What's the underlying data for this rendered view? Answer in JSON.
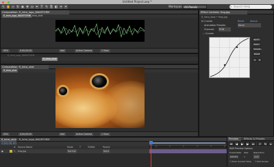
{
  "window": {
    "title": "Untitled Project.aep *"
  },
  "toolbar": {
    "workspace_label": "Workspace:",
    "workspace_value": "All Panels",
    "search_placeholder": "Search Help"
  },
  "composition_top": {
    "tab_label": "Composition: fl_intro_logo_WAVEFORM",
    "subtabs": [
      "fl_intro_logo_WAVEFORM",
      "fl_intro_shot"
    ],
    "zoom": "50%",
    "time": "0;00;00;00",
    "resolution": "Half",
    "camera": "Active Camera",
    "views": "1 View"
  },
  "layer_top": {
    "path": "fl_intro_logo_WAVEFORM",
    "subtab_active": "fl_intro_shot"
  },
  "composition_bottom": {
    "tab_label": "Composition: fl_intro_shot",
    "subtabs": [
      "fl_intro_shot"
    ],
    "zoom": "50%",
    "time": "0;00;00;00",
    "resolution": "Half",
    "camera": "Active Camera",
    "views": "1 View"
  },
  "effects": {
    "tab_label": "Effect Controls: frog.jpg",
    "layer_path": "fl_intro_shot • frog.jpg",
    "effect_name": "fx Curves",
    "reset": "Reset",
    "about": "About...",
    "preset_label": "Animation Presets:",
    "preset_value": "None",
    "channel_label": "Channel:",
    "channel_value": "RGB",
    "curves_label": "Curves",
    "buttons": [
      "Open...",
      "Save...",
      "Smooth",
      "Reset"
    ]
  },
  "timeline": {
    "tabs": [
      "fl_intro_shot",
      "fl_intro_logo_WAVEFORM"
    ],
    "time": "0;00;00;00",
    "columns": [
      "#",
      "Source Name",
      "Mode",
      "T",
      "TrkMat",
      "Parent"
    ],
    "layer": {
      "index": "1",
      "name": "frog.jpg",
      "mode": "Normal",
      "parent": "None"
    }
  },
  "preview": {
    "tabs": [
      "Preview",
      "Effects & Presets"
    ],
    "ram_label": "RAM Preview Options",
    "frame_rate_label": "Frame Rate",
    "skip_label": "Skip",
    "resolution_label": "Resolution",
    "frame_rate_value": "(29.97)",
    "skip_value": "0",
    "resolution_value": "Auto",
    "from_current": "From Current Time",
    "full_screen": "Full Screen"
  },
  "colors": {
    "layer_label": "#c9b447",
    "track": "#6b5d8a",
    "cti": "#e04040",
    "waveform": "#7fe07f"
  }
}
